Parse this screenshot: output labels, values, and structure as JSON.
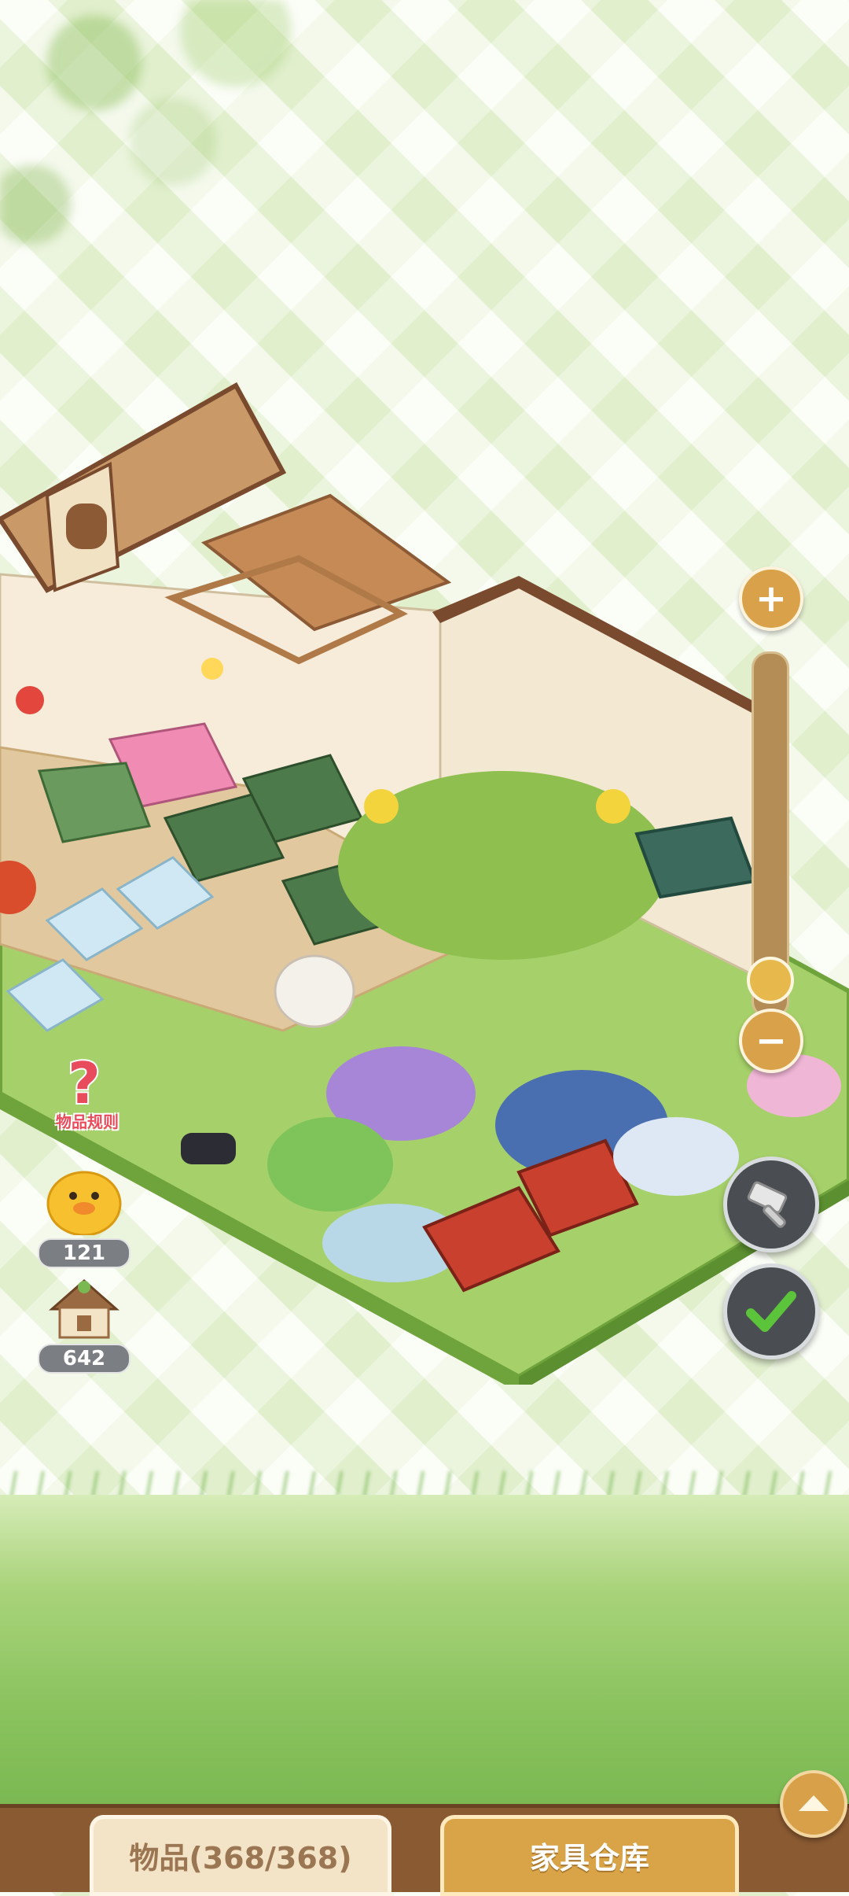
{
  "hud": {
    "help_label": "物品规则",
    "duck_count": "121",
    "house_count": "642"
  },
  "zoom": {
    "plus_symbol": "+",
    "minus_symbol": "−"
  },
  "tabs": {
    "items_label": "物品(368/368)",
    "warehouse_label": "家具仓库"
  },
  "colors": {
    "accent_gold": "#d9a24a",
    "bar_brown": "#8a5a32",
    "check_green": "#5cc43a"
  }
}
